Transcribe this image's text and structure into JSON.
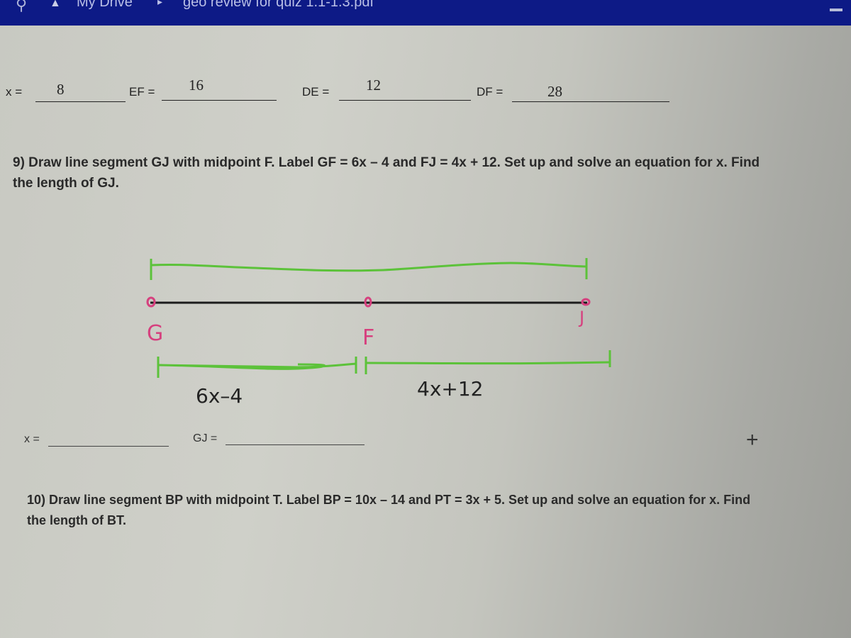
{
  "topbar": {
    "search_icon": "search-icon",
    "drive_icon": "google-drive-icon",
    "breadcrumb_root": "My Drive",
    "breadcrumb_separator": "▸",
    "file_name": "geo review for quiz 1.1-1.3.pdf",
    "background_color": "#0d1a86"
  },
  "previous_answers": {
    "x_label": "x =",
    "x_value": "8",
    "ef_label": "EF =",
    "ef_value": "16",
    "de_label": "DE =",
    "de_value": "12",
    "df_label": "DF =",
    "df_value": "28"
  },
  "problem9": {
    "line1": "9)  Draw line segment GJ with midpoint F.  Label GF = 6x – 4 and FJ = 4x + 12.  Set up and solve an equation for x.  Find",
    "line2": "the length of GJ.",
    "drawing": {
      "points": [
        "G",
        "F",
        "J"
      ],
      "left_label": "6x–4",
      "right_label": "4x+12",
      "point_color": "#d6407e",
      "bracket_color": "#5cc23a"
    },
    "x_label": "x =",
    "x_value": "",
    "gj_label": "GJ =",
    "gj_value": ""
  },
  "problem10": {
    "line1": "10)  Draw line segment BP with midpoint T.  Label BP = 10x – 14 and PT = 3x + 5.  Set up and solve an equation for x.  Find",
    "line2": "the length of BT."
  },
  "controls": {
    "zoom_in": "+"
  }
}
